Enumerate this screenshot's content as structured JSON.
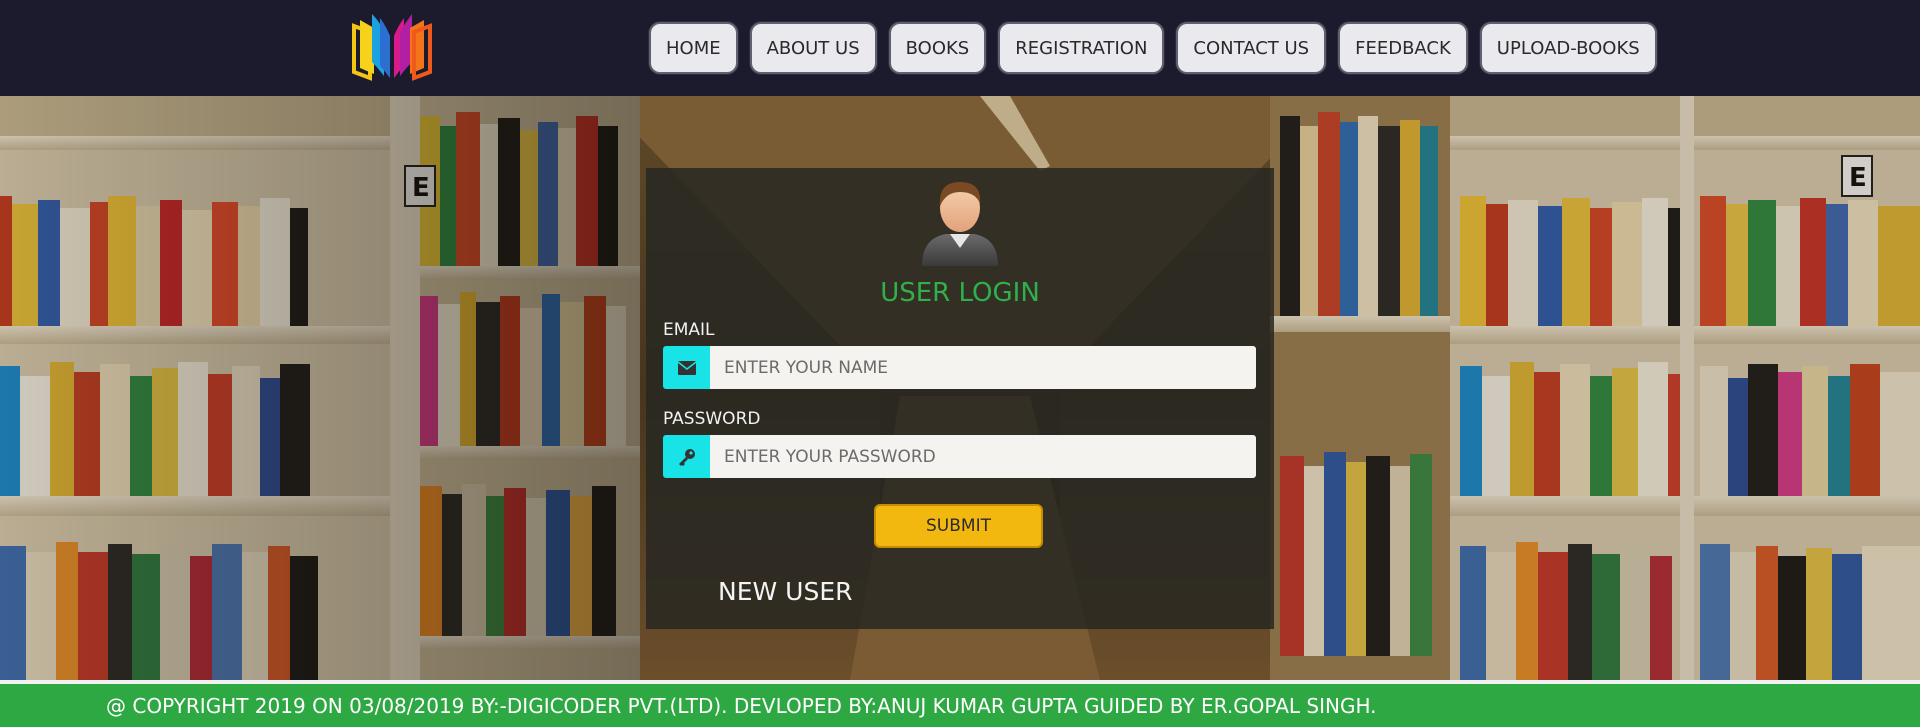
{
  "nav": {
    "items": [
      {
        "label": "HOME"
      },
      {
        "label": "ABOUT US"
      },
      {
        "label": "BOOKS"
      },
      {
        "label": "REGISTRATION"
      },
      {
        "label": "CONTACT US"
      },
      {
        "label": "FEEDBACK"
      },
      {
        "label": "UPLOAD-BOOKS"
      }
    ]
  },
  "login": {
    "title": "USER LOGIN",
    "email_label": "EMAIL",
    "email_placeholder": "ENTER YOUR NAME",
    "email_icon": "envelope-icon",
    "password_label": "PASSWORD",
    "password_placeholder": "ENTER YOUR PASSWORD",
    "password_icon": "key-icon",
    "submit_label": "SUBMIT",
    "new_user_label": "NEW USER"
  },
  "footer": {
    "text": "@ COPYRIGHT 2019 ON 03/08/2019 BY:-DIGICODER PVT.(LTD). DEVLOPED BY:ANUJ KUMAR GUPTA GUIDED BY ER.GOPAL SINGH."
  },
  "colors": {
    "header_bg": "#1c1b2e",
    "accent_green": "#2fb04a",
    "icon_cyan": "#18e3e6",
    "submit_yellow": "#f2b80f",
    "footer_green": "#2ea843"
  }
}
